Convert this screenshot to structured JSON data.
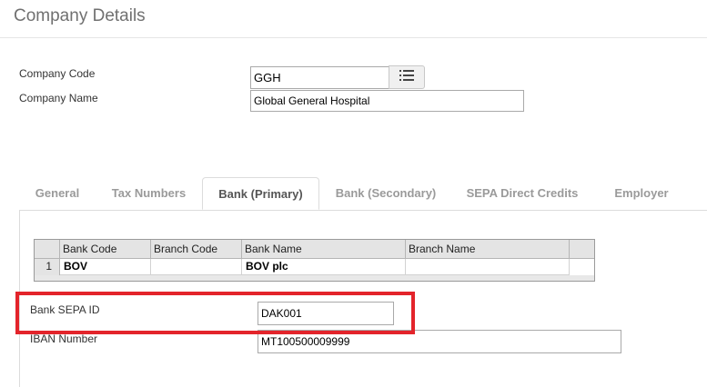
{
  "page": {
    "title": "Company Details"
  },
  "company": {
    "code_label": "Company Code",
    "code_value": "GGH",
    "name_label": "Company Name",
    "name_value": "Global General Hospital",
    "lookup_icon": "list-icon"
  },
  "tabs": [
    {
      "label": "General",
      "active": false
    },
    {
      "label": "Tax Numbers",
      "active": false
    },
    {
      "label": "Bank (Primary)",
      "active": true
    },
    {
      "label": "Bank (Secondary)",
      "active": false
    },
    {
      "label": "SEPA Direct Credits",
      "active": false
    },
    {
      "label": "Employer",
      "active": false
    }
  ],
  "bank_grid": {
    "columns": [
      "Bank Code",
      "Branch Code",
      "Bank Name",
      "Branch Name"
    ],
    "rows": [
      {
        "row_number": "1",
        "cells": [
          "BOV",
          "",
          "BOV plc",
          ""
        ]
      }
    ]
  },
  "bank_fields": {
    "sepa_label": "Bank SEPA ID",
    "sepa_value": "DAK001",
    "iban_label": "IBAN Number",
    "iban_value": "MT100500009999"
  },
  "colors": {
    "highlight": "#e3242b",
    "active_tab_text": "#555555",
    "inactive_tab_text": "#9a9a9a"
  }
}
